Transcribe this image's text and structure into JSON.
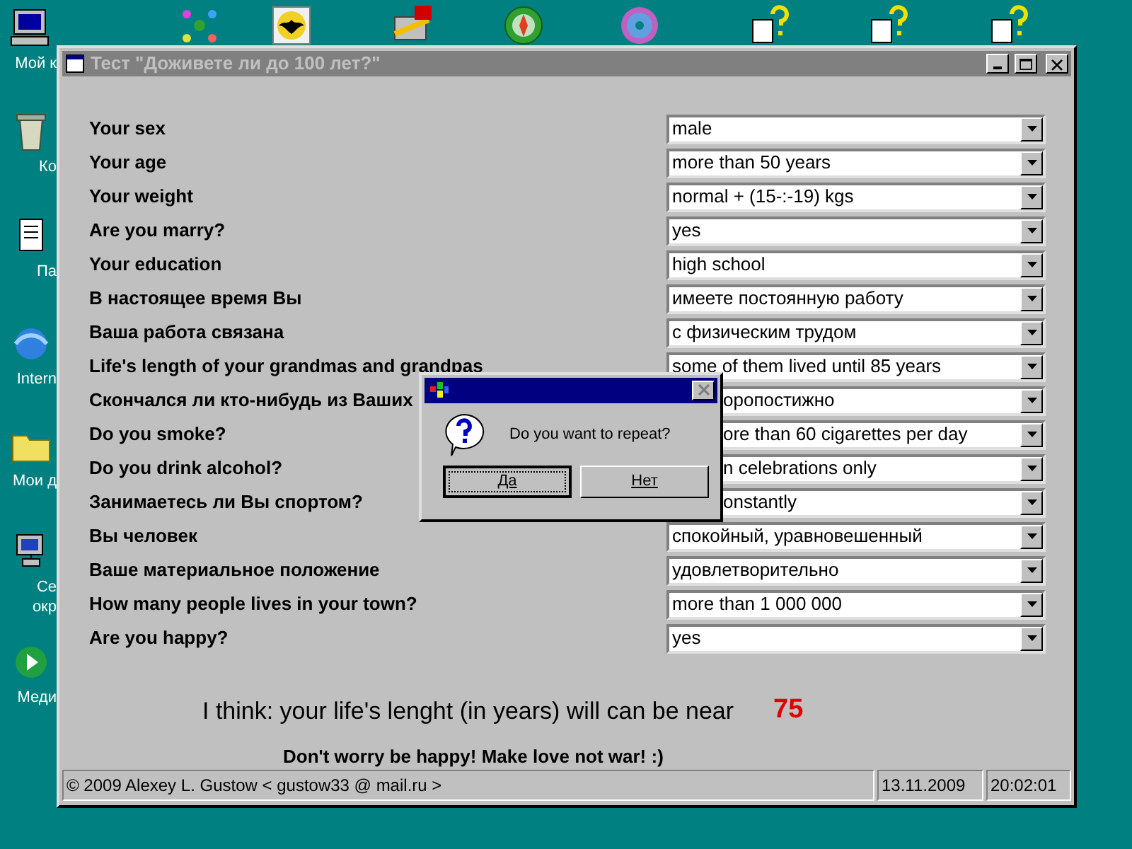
{
  "desktop": {
    "icons": [
      {
        "label": "Мой к"
      },
      {
        "label": "Ко"
      },
      {
        "label": "Па"
      },
      {
        "label": "Intern"
      },
      {
        "label": "Мои д"
      },
      {
        "label": "Се\nокр"
      },
      {
        "label": "Меди"
      }
    ]
  },
  "window": {
    "title": "Тест \"Доживете ли до 100 лет?\""
  },
  "questions": [
    {
      "label": "Your sex",
      "value": "male"
    },
    {
      "label": "Your age",
      "value": "more than 50 years"
    },
    {
      "label": "Your weight",
      "value": "normal + (15-:-19) kgs"
    },
    {
      "label": "Are you marry?",
      "value": "yes"
    },
    {
      "label": "Your education",
      "value": "high school"
    },
    {
      "label": "В настоящее время Вы",
      "value": "имеете постоянную работу"
    },
    {
      "label": "Ваша работа связана",
      "value": "с физическим трудом"
    },
    {
      "label": "Life's length of your grandmas and grandpas",
      "value": "some of them lived until 85 years"
    },
    {
      "label": "Скончался ли кто-нибудь из Ваших",
      "value": "оропостижно"
    },
    {
      "label": "Do you smoke?",
      "value": "ore than 60 cigarettes per day"
    },
    {
      "label": "Do you drink alcohol?",
      "value": "n celebrations only"
    },
    {
      "label": "Занимаетесь ли Вы спортом?",
      "value": "onstantly"
    },
    {
      "label": "Вы человек",
      "value": "спокойный, уравновешенный"
    },
    {
      "label": "Ваше материальное положение",
      "value": "удовлетворительно"
    },
    {
      "label": "How many people lives in your town?",
      "value": "more than 1 000 000"
    },
    {
      "label": "Are you happy?",
      "value": "yes"
    }
  ],
  "result": {
    "text": "I think: your life's lenght (in years) will can be near",
    "value": "75",
    "motto": "Don't worry be happy! Make love not war! :)"
  },
  "status_bar": {
    "copyright": "© 2009 Alexey L. Gustow < gustow33 @ mail.ru >",
    "date": "13.11.2009",
    "time": "20:02:01"
  },
  "dialog": {
    "message": "Do you want to repeat?",
    "buttons": [
      {
        "label": "Да",
        "focused": true
      },
      {
        "label": "Нет",
        "focused": false
      }
    ]
  }
}
